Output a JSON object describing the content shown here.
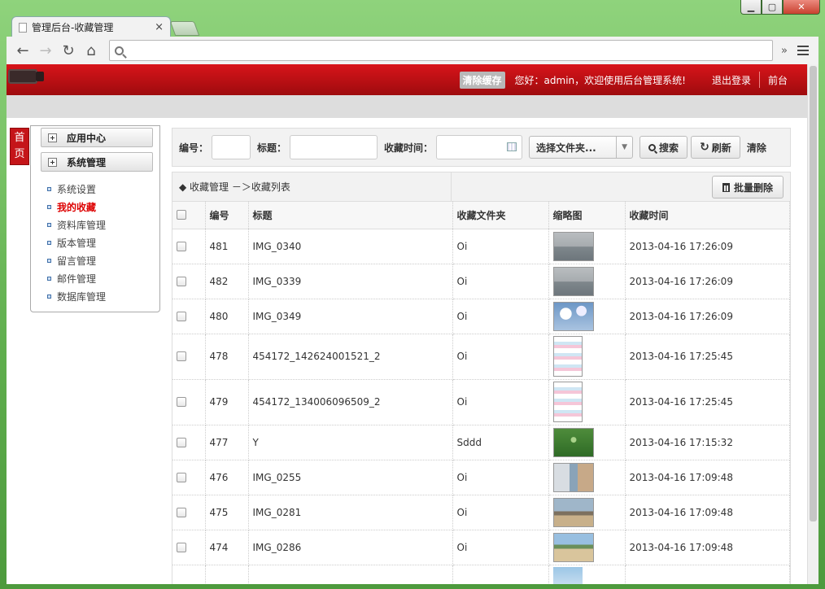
{
  "browser": {
    "tab_title": "管理后台-收藏管理",
    "tab_close": "×",
    "omnibox_value": "",
    "overflow": "»"
  },
  "topbar": {
    "clear_cache": "清除缓存",
    "greeting": "您好：admin，欢迎使用后台管理系统!",
    "logout": "退出登录",
    "frontend": "前台"
  },
  "home_tab": "首页",
  "sidebar": {
    "groups": [
      "应用中心",
      "系统管理"
    ],
    "items": [
      "系统设置",
      "我的收藏",
      "资料库管理",
      "版本管理",
      "留言管理",
      "邮件管理",
      "数据库管理"
    ],
    "active_index": 1
  },
  "search": {
    "id_label": "编号：",
    "title_label": "标题：",
    "time_label": "收藏时间：",
    "folder_select": "选择文件夹...",
    "search_btn": "搜索",
    "refresh_btn": "刷新",
    "clear_btn": "清除"
  },
  "grid": {
    "breadcrumb": "◆ 收藏管理 －＞收藏列表",
    "batch_delete": "批量删除",
    "columns": [
      "编号",
      "标题",
      "收藏文件夹",
      "缩略图",
      "收藏时间"
    ],
    "rows": [
      {
        "id": "481",
        "title": "IMG_0340",
        "folder": "Oi",
        "time": "2013-04-16 17:26:09",
        "thumb": "sea-gray"
      },
      {
        "id": "482",
        "title": "IMG_0339",
        "folder": "Oi",
        "time": "2013-04-16 17:26:09",
        "thumb": "sea-gray"
      },
      {
        "id": "480",
        "title": "IMG_0349",
        "folder": "Oi",
        "time": "2013-04-16 17:26:09",
        "thumb": "sky-clouds"
      },
      {
        "id": "478",
        "title": "454172_142624001521_2",
        "folder": "Oi",
        "time": "2013-04-16 17:25:45",
        "thumb": "collage-pink"
      },
      {
        "id": "479",
        "title": "454172_134006096509_2",
        "folder": "Oi",
        "time": "2013-04-16 17:25:45",
        "thumb": "collage-pink"
      },
      {
        "id": "477",
        "title": "Y",
        "folder": "Sddd",
        "time": "2013-04-16 17:15:32",
        "thumb": "green-y"
      },
      {
        "id": "476",
        "title": "IMG_0255",
        "folder": "Oi",
        "time": "2013-04-16 17:09:48",
        "thumb": "beach-window"
      },
      {
        "id": "475",
        "title": "IMG_0281",
        "folder": "Oi",
        "time": "2013-04-16 17:09:48",
        "thumb": "beach-rocks"
      },
      {
        "id": "474",
        "title": "IMG_0286",
        "folder": "Oi",
        "time": "2013-04-16 17:09:48",
        "thumb": "beach-palms"
      }
    ]
  }
}
